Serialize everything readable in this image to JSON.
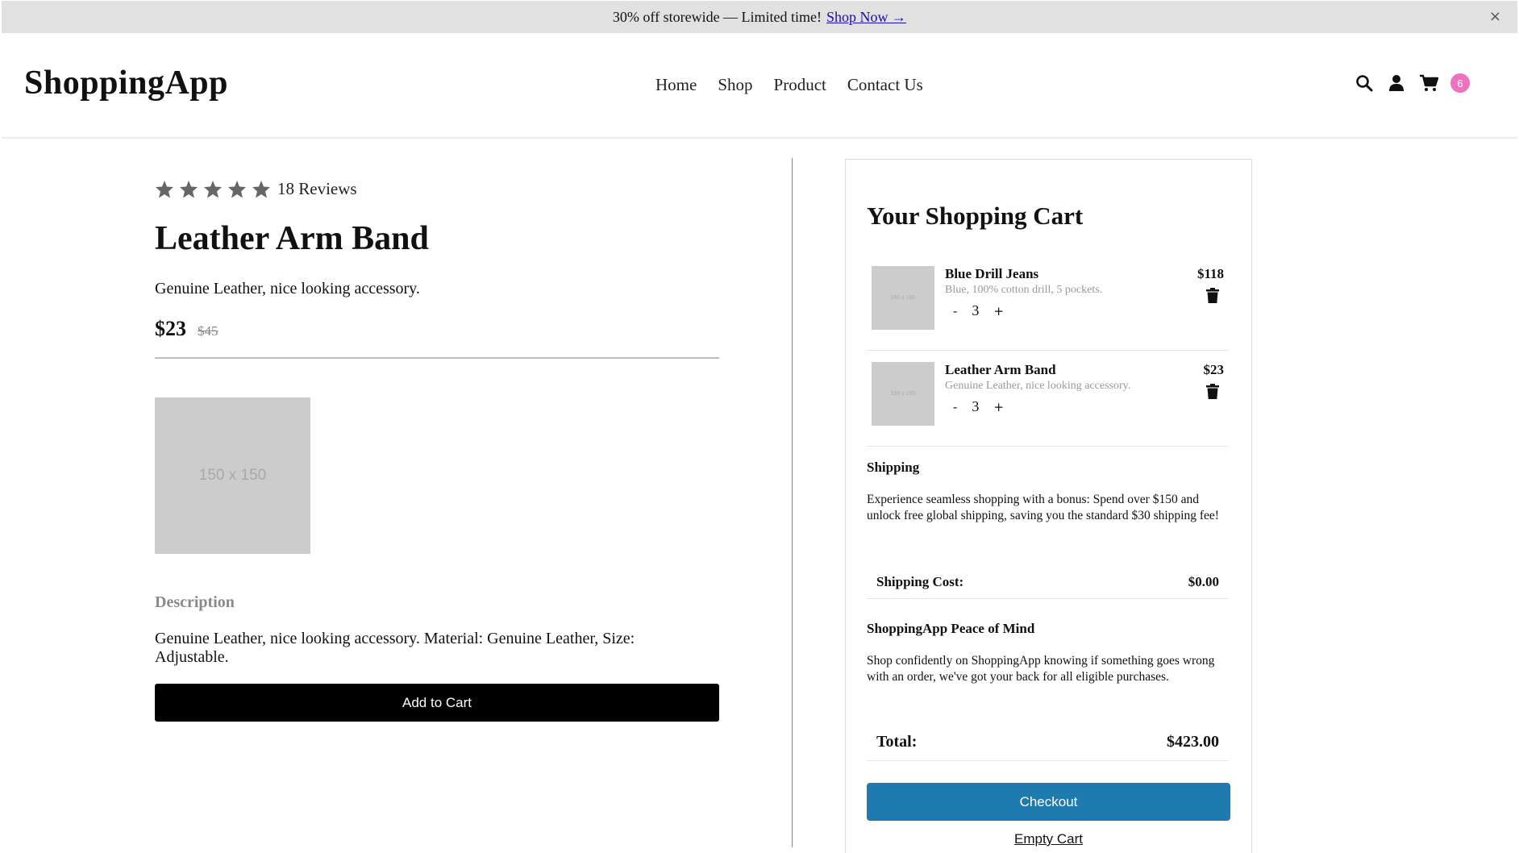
{
  "announcement": {
    "text": "30% off storewide — Limited time!",
    "link": "Shop Now →",
    "close": "×"
  },
  "header": {
    "logo": "ShoppingApp",
    "nav": [
      "Home",
      "Shop",
      "Product",
      "Contact Us"
    ],
    "icons": [
      "search-icon",
      "user-icon",
      "cart-icon"
    ],
    "cart_count": "6",
    "badge_color": "#ee72bf"
  },
  "product": {
    "rating": 5,
    "reviews": "18 Reviews",
    "title": "Leather Arm Band",
    "subtitle": "Genuine Leather, nice looking accessory.",
    "price": "$23",
    "original_price": "$45",
    "image_placeholder": "150 x 150",
    "description_label": "Description",
    "description": "Genuine Leather, nice looking accessory. Material: Genuine Leather, Size: Adjustable.",
    "add_to_cart": "Add to Cart"
  },
  "cart": {
    "title": "Your Shopping Cart",
    "items": [
      {
        "name": "Blue Drill Jeans",
        "description": "Blue, 100% cotton drill, 5 pockets.",
        "price": "$118",
        "quantity": "3",
        "image_placeholder": "150 x 150"
      },
      {
        "name": "Leather Arm Band",
        "description": "Genuine Leather, nice looking accessory.",
        "price": "$23",
        "quantity": "3",
        "image_placeholder": "150 x 150"
      }
    ],
    "shipping_heading": "Shipping",
    "shipping_text": "Experience seamless shopping with a bonus: Spend over $150 and unlock free global shipping, saving you the standard $30 shipping fee!",
    "shipping_cost_label": "Shipping Cost:",
    "shipping_cost": "$0.00",
    "peace_heading": "ShoppingApp Peace of Mind",
    "peace_text": "Shop confidently on ShoppingApp knowing if something goes wrong with an order, we've got your back for all eligible purchases.",
    "total_label": "Total:",
    "total": "$423.00",
    "checkout": "Checkout",
    "checkout_color": "#1e7aaf",
    "empty": "Empty Cart"
  }
}
